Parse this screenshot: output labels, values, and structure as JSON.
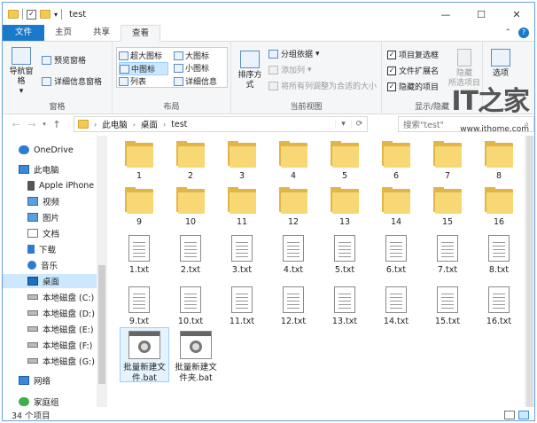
{
  "window": {
    "title": "test",
    "controls": {
      "minimize": "—",
      "maximize": "☐",
      "close": "✕"
    }
  },
  "ribbon_tabs": [
    "文件",
    "主页",
    "共享",
    "查看"
  ],
  "ribbon": {
    "pane": {
      "nav_pane": "导航窗格",
      "preview_pane": "预览窗格",
      "details_pane": "详细信息窗格",
      "group": "窗格"
    },
    "layout": {
      "items": [
        "超大图标",
        "大图标",
        "中图标",
        "小图标",
        "列表",
        "详细信息"
      ],
      "selected": "中图标",
      "group": "布局"
    },
    "current_view": {
      "sort_by": "排序方式",
      "group_by": "分组依据",
      "add_column": "添加列",
      "fit_columns": "将所有列调整为合适的大小",
      "group": "当前视图"
    },
    "show_hide": {
      "item_checkboxes": "项目复选框",
      "file_extensions": "文件扩展名",
      "hidden_items": "隐藏的项目",
      "hide_label": "隐藏",
      "hide_label2": "所选项目",
      "group": "显示/隐藏"
    },
    "options": "选项"
  },
  "address": {
    "crumbs": [
      "此电脑",
      "桌面",
      "test"
    ]
  },
  "search": {
    "placeholder": "搜索\"test\""
  },
  "watermark": {
    "logo": "IT之家",
    "url": "www.ithome.com"
  },
  "nav": [
    {
      "label": "OneDrive",
      "icon": "cloud-icon"
    },
    {
      "label": "此电脑",
      "icon": "computer-icon"
    },
    {
      "label": "Apple iPhone",
      "icon": "phone-icon"
    },
    {
      "label": "视频",
      "icon": "video-icon"
    },
    {
      "label": "图片",
      "icon": "picture-icon"
    },
    {
      "label": "文档",
      "icon": "document-icon"
    },
    {
      "label": "下载",
      "icon": "download-icon"
    },
    {
      "label": "音乐",
      "icon": "music-icon"
    },
    {
      "label": "桌面",
      "icon": "desktop-icon",
      "selected": true
    },
    {
      "label": "本地磁盘 (C:)",
      "icon": "drive-icon"
    },
    {
      "label": "本地磁盘 (D:)",
      "icon": "drive-icon"
    },
    {
      "label": "本地磁盘 (E:)",
      "icon": "drive-icon"
    },
    {
      "label": "本地磁盘 (F:)",
      "icon": "drive-icon"
    },
    {
      "label": "本地磁盘 (G:)",
      "icon": "drive-icon"
    },
    {
      "label": "网络",
      "icon": "network-icon"
    },
    {
      "label": "家庭组",
      "icon": "homegroup-icon"
    }
  ],
  "folders": [
    "1",
    "2",
    "3",
    "4",
    "5",
    "6",
    "7",
    "8",
    "9",
    "10",
    "11",
    "12",
    "13",
    "14",
    "15",
    "16"
  ],
  "txt_files": [
    "1.txt",
    "2.txt",
    "3.txt",
    "4.txt",
    "5.txt",
    "6.txt",
    "7.txt",
    "8.txt",
    "9.txt",
    "10.txt",
    "11.txt",
    "12.txt",
    "13.txt",
    "14.txt",
    "15.txt",
    "16.txt"
  ],
  "bat_files": [
    "批量新建文件.bat",
    "批量新建文件夹.bat"
  ],
  "status": {
    "count": "34 个项目"
  }
}
